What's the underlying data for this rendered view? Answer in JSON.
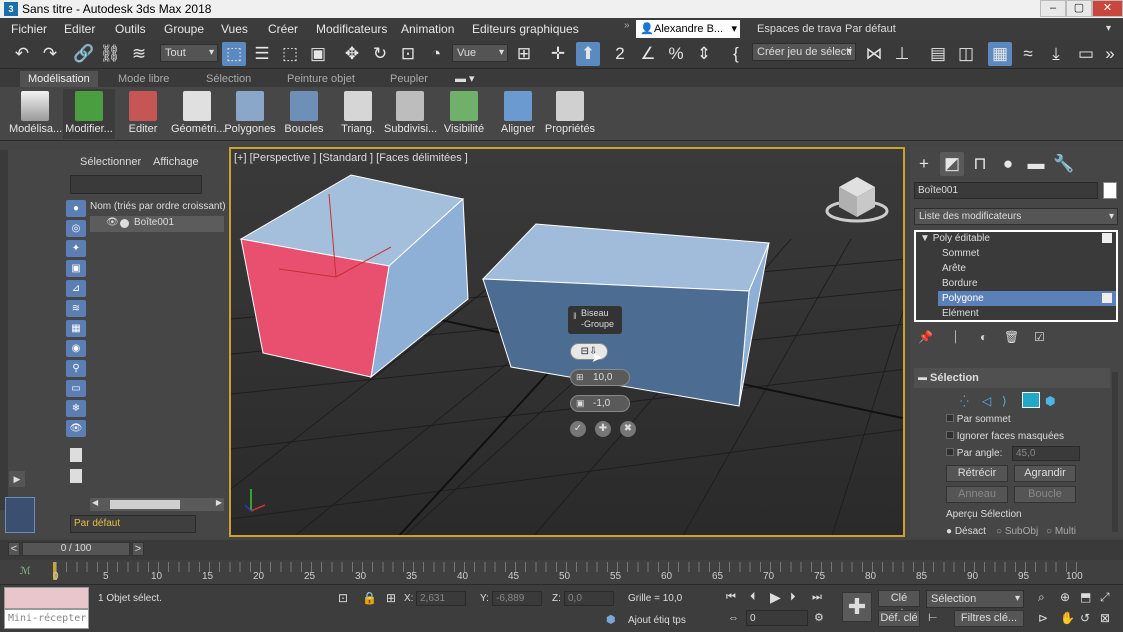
{
  "window": {
    "title": "Sans titre - Autodesk 3ds Max 2018",
    "logo": "3"
  },
  "menu": [
    "Fichier",
    "Editer",
    "Outils",
    "Groupe",
    "Vues",
    "Créer",
    "Modificateurs",
    "Animation",
    "Editeurs graphiques"
  ],
  "user": {
    "name": "Alexandre B...",
    "workspace_label": "Espaces de travail:",
    "workspace_value": "Par défaut"
  },
  "toolbar": {
    "filter": "Tout",
    "ref_coord": "Vue",
    "create_selection": "Créer jeu de sélecti "
  },
  "ribbon_tabs": [
    "Modélisation",
    "Mode libre",
    "Sélection",
    "Peinture objet",
    "Peupler"
  ],
  "ribbon_buttons": [
    "Modélisa...",
    "Modifier...",
    "Editer",
    "Géométri...",
    "Polygones",
    "Boucles",
    "Triang.",
    "Subdivisi...",
    "Visibilité",
    "Aligner",
    "Propriétés"
  ],
  "scene_explorer": {
    "menu_select": "Sélectionner",
    "menu_display": "Affichage",
    "column": "Nom (triés par ordre croissant)",
    "item": "Boîte001",
    "layer": "Par défaut"
  },
  "viewport": {
    "label": "[+] [Perspective ] [Standard ] [Faces délimitées ]"
  },
  "caddy": {
    "title_line1": "Biseau",
    "title_line2": "-Groupe",
    "height": "10,0",
    "outline": "-1,0"
  },
  "command_panel": {
    "object_name": "Boîte001",
    "modifier_list": "Liste des modificateurs",
    "stack": [
      "Poly éditable",
      "Sommet",
      "Arête",
      "Bordure",
      "Polygone",
      "Elément"
    ],
    "rollout_title": "Sélection",
    "by_vertex": "Par sommet",
    "ignore_backfacing": "Ignorer faces masquées",
    "by_angle": "Par angle:",
    "angle_value": "45,0",
    "shrink": "Rétrécir",
    "grow": "Agrandir",
    "ring": "Anneau",
    "loop": "Boucle",
    "preview_title": "Aperçu Sélection",
    "preview_off": "Désact",
    "preview_subobj": "SubObj",
    "preview_multi": "Multi"
  },
  "timeline": {
    "frame": "0 / 100",
    "prev": "<",
    "next": ">"
  },
  "ruler_ticks": [
    "0",
    "5",
    "10",
    "15",
    "20",
    "25",
    "30",
    "35",
    "40",
    "45",
    "50",
    "55",
    "60",
    "65",
    "70",
    "75",
    "80",
    "85",
    "90",
    "95",
    "100"
  ],
  "status": {
    "mini_listener": "Mini-récepter",
    "selection": "1 Objet sélect.",
    "x_label": "X:",
    "x_value": "2,631",
    "y_label": "Y:",
    "y_value": "-6,889",
    "z_label": "Z:",
    "z_value": "0,0",
    "grid": "Grille = 10,0",
    "add_tag": "Ajout étiq tps",
    "auto_key": "Clé auto",
    "set_key": "Déf. clé",
    "key_filter_sel": "Sélection",
    "key_filters": "Filtres clé...",
    "frame_input": "0"
  }
}
